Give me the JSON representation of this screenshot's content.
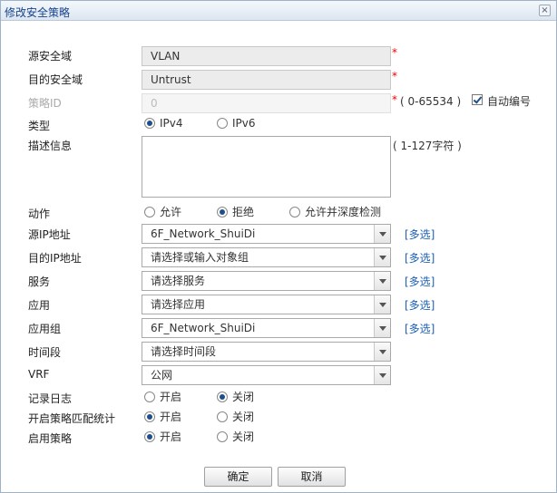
{
  "dialog": {
    "title": "修改安全策略",
    "close_label": "×"
  },
  "form": {
    "src_zone": {
      "label": "源安全域",
      "value": "VLAN",
      "required": "*"
    },
    "dst_zone": {
      "label": "目的安全域",
      "value": "Untrust",
      "required": "*"
    },
    "policy_id": {
      "label": "策略ID",
      "value": "0",
      "required": "*",
      "range": "( 0-65534 )",
      "auto_label": "自动编号"
    },
    "type": {
      "label": "类型",
      "options": [
        "IPv4",
        "IPv6"
      ],
      "selected": "IPv4"
    },
    "description": {
      "label": "描述信息",
      "value": "",
      "range": "( 1-127字符 )"
    },
    "action": {
      "label": "动作",
      "options": [
        "允许",
        "拒绝",
        "允许并深度检测"
      ],
      "selected": "拒绝"
    },
    "src_ip": {
      "label": "源IP地址",
      "value": "6F_Network_ShuiDi",
      "multi": "[多选]"
    },
    "dst_ip": {
      "label": "目的IP地址",
      "value": "请选择或输入对象组",
      "multi": "[多选]"
    },
    "service": {
      "label": "服务",
      "value": "请选择服务",
      "multi": "[多选]"
    },
    "application": {
      "label": "应用",
      "value": "请选择应用",
      "multi": "[多选]"
    },
    "app_group": {
      "label": "应用组",
      "value": "6F_Network_ShuiDi",
      "multi": "[多选]"
    },
    "time_range": {
      "label": "时间段",
      "value": "请选择时间段"
    },
    "vrf": {
      "label": "VRF",
      "value": "公网"
    },
    "log": {
      "label": "记录日志",
      "options": [
        "开启",
        "关闭"
      ],
      "selected": "关闭"
    },
    "match_stats": {
      "label": "开启策略匹配统计",
      "options": [
        "开启",
        "关闭"
      ],
      "selected": "开启"
    },
    "enable_policy": {
      "label": "启用策略",
      "options": [
        "开启",
        "关闭"
      ],
      "selected": "开启"
    }
  },
  "buttons": {
    "ok": "确定",
    "cancel": "取消"
  }
}
